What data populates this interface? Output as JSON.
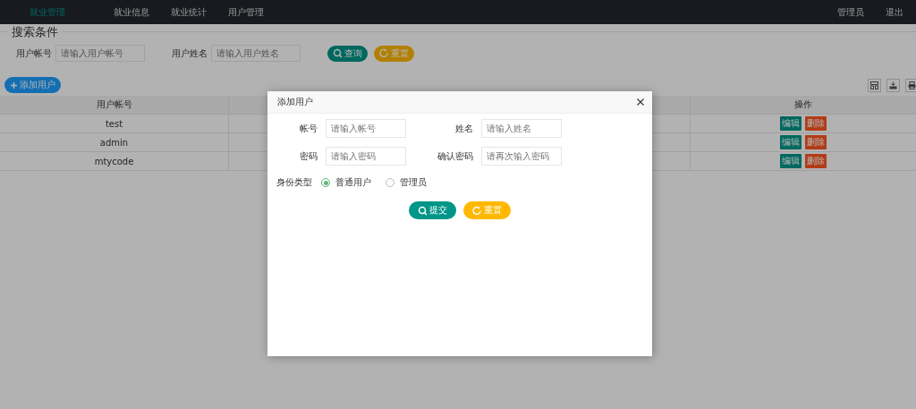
{
  "nav": {
    "brand": "就业管理",
    "items": [
      "就业信息",
      "就业统计",
      "用户管理"
    ],
    "user": "管理员",
    "logout": "退出"
  },
  "search": {
    "legend": "搜索条件",
    "fields": [
      {
        "label": "用户帐号",
        "placeholder": "请输入用户帐号"
      },
      {
        "label": "用户姓名",
        "placeholder": "请输入用户姓名"
      }
    ],
    "query_button": "查询",
    "reset_button": "重置"
  },
  "toolbar": {
    "add_button": "添加用户"
  },
  "table": {
    "columns": [
      "用户帐号",
      "操作"
    ],
    "rows": [
      {
        "account": "test",
        "edit": "编辑",
        "delete": "删除"
      },
      {
        "account": "admin",
        "edit": "编辑",
        "delete": "删除"
      },
      {
        "account": "mtycode",
        "edit": "编辑",
        "delete": "删除"
      }
    ]
  },
  "dialog": {
    "title": "添加用户",
    "fields": [
      {
        "label": "帐号",
        "placeholder": "请输入帐号"
      },
      {
        "label": "姓名",
        "placeholder": "请输入姓名"
      },
      {
        "label": "密码",
        "placeholder": "请输入密码"
      },
      {
        "label": "确认密码",
        "placeholder": "请再次输入密码"
      }
    ],
    "role": {
      "label": "身份类型",
      "options": [
        {
          "label": "普通用户",
          "selected": true
        },
        {
          "label": "管理员",
          "selected": false
        }
      ]
    },
    "submit": "提交",
    "reset": "重置"
  }
}
